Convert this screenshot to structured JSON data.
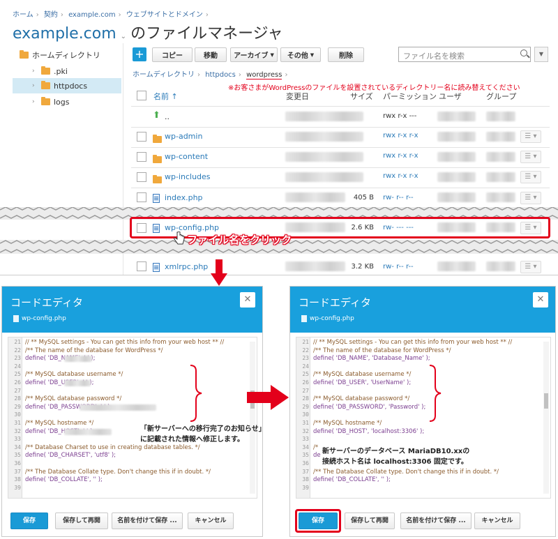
{
  "breadcrumb": [
    "ホーム",
    "契約",
    "example.com",
    "ウェブサイトとドメイン"
  ],
  "page_title": "example.com",
  "page_title_suffix": "のファイルマネージャ",
  "sidebar": {
    "items": [
      {
        "label": "ホームディレクトリ"
      },
      {
        "label": ".pki"
      },
      {
        "label": "httpdocs"
      },
      {
        "label": "logs"
      }
    ]
  },
  "toolbar": {
    "add": "+",
    "copy": "コピー",
    "move": "移動",
    "archive": "アーカイブ",
    "other": "その他",
    "delete": "削除",
    "search_placeholder": "ファイル名を検索"
  },
  "path": [
    "ホームディレクトリ",
    "httpdocs",
    "wordpress"
  ],
  "note": "※お客さまがWordPressのファイルを設置されているディレクトリー名に読み替えてください",
  "columns": [
    "名前 ↑",
    "変更日",
    "サイズ",
    "パーミッション",
    "ユーザ",
    "グループ"
  ],
  "files": [
    {
      "name": "..",
      "size": "",
      "perm": "rwx r-x ---"
    },
    {
      "name": "wp-admin",
      "size": "",
      "perm": "rwx r-x r-x"
    },
    {
      "name": "wp-content",
      "size": "",
      "perm": "rwx r-x r-x"
    },
    {
      "name": "wp-includes",
      "size": "",
      "perm": "rwx r-x r-x"
    },
    {
      "name": "index.php",
      "size": "405 B",
      "perm": "rw- r-- r--"
    },
    {
      "name": "wp-config.php",
      "size": "2.6 KB",
      "perm": "rw- --- ---"
    },
    {
      "name": "xmlrpc.php",
      "size": "3.2 KB",
      "perm": "rw- r-- r--"
    }
  ],
  "callout_click": "ファイル名をクリック",
  "editor_left": {
    "title": "コードエディタ",
    "file": "wp-config.php",
    "lines": [
      {
        "n": "21",
        "t": "// ** MySQL settings - You can get this info from your web host ** //"
      },
      {
        "n": "22",
        "t": "/** The name of the database for WordPress */"
      },
      {
        "n": "23",
        "t": "define( 'DB_NAME', '          ' );"
      },
      {
        "n": "24",
        "t": ""
      },
      {
        "n": "25",
        "t": "/** MySQL database username */"
      },
      {
        "n": "26",
        "t": "define( 'DB_USER', '        ' );"
      },
      {
        "n": "27",
        "t": ""
      },
      {
        "n": "28",
        "t": "/** MySQL database password */"
      },
      {
        "n": "29",
        "t": "define( 'DB_PASSWORD', '                    ' );"
      },
      {
        "n": "30",
        "t": ""
      },
      {
        "n": "31",
        "t": "/** MySQL hostname */"
      },
      {
        "n": "32",
        "t": "define( 'DB_HOST', '                  ' );"
      },
      {
        "n": "33",
        "t": ""
      },
      {
        "n": "34",
        "t": "/** Database Charset to use in creating database tables. */"
      },
      {
        "n": "35",
        "t": "define( 'DB_CHARSET', 'utf8' );"
      },
      {
        "n": "36",
        "t": ""
      },
      {
        "n": "37",
        "t": "/** The Database Collate type. Don't change this if in doubt. */"
      },
      {
        "n": "38",
        "t": "define( 'DB_COLLATE', '' );"
      },
      {
        "n": "39",
        "t": ""
      }
    ],
    "annotation_line1": "「新サーバーへの移行完了のお知らせ」",
    "annotation_line2": "に記載された情報へ修正します。"
  },
  "editor_right": {
    "title": "コードエディタ",
    "file": "wp-config.php",
    "lines": [
      {
        "n": "21",
        "t": "// ** MySQL settings - You can get this info from your web host ** //"
      },
      {
        "n": "22",
        "t": "/** The name of the database for WordPress */"
      },
      {
        "n": "23",
        "t": "define( 'DB_NAME', 'Database_Name' );"
      },
      {
        "n": "24",
        "t": ""
      },
      {
        "n": "25",
        "t": "/** MySQL database username */"
      },
      {
        "n": "26",
        "t": "define( 'DB_USER', 'UserName' );"
      },
      {
        "n": "27",
        "t": ""
      },
      {
        "n": "28",
        "t": "/** MySQL database password */"
      },
      {
        "n": "29",
        "t": "define( 'DB_PASSWORD', 'Password' );"
      },
      {
        "n": "30",
        "t": ""
      },
      {
        "n": "31",
        "t": "/** MySQL hostname */"
      },
      {
        "n": "32",
        "t": "define( 'DB_HOST', 'localhost:3306' );"
      },
      {
        "n": "33",
        "t": ""
      },
      {
        "n": "34",
        "t": "/*"
      },
      {
        "n": "35",
        "t": "de"
      },
      {
        "n": "36",
        "t": ""
      },
      {
        "n": "37",
        "t": "/** The Database Collate type. Don't change this if in doubt. */"
      },
      {
        "n": "38",
        "t": "define( 'DB_COLLATE', '' );"
      },
      {
        "n": "39",
        "t": ""
      }
    ],
    "annotation_line1": "新サーバーのデータベース MariaDB10.xxの",
    "annotation_line2": "接続ホスト名は localhost:3306 固定です。"
  },
  "editor_buttons": {
    "save": "保存",
    "save_reopen": "保存して再開",
    "save_as": "名前を付けて保存 ...",
    "cancel": "キャンセル"
  },
  "colors": {
    "accent": "#1a9ad6",
    "highlight": "#e3001b"
  }
}
